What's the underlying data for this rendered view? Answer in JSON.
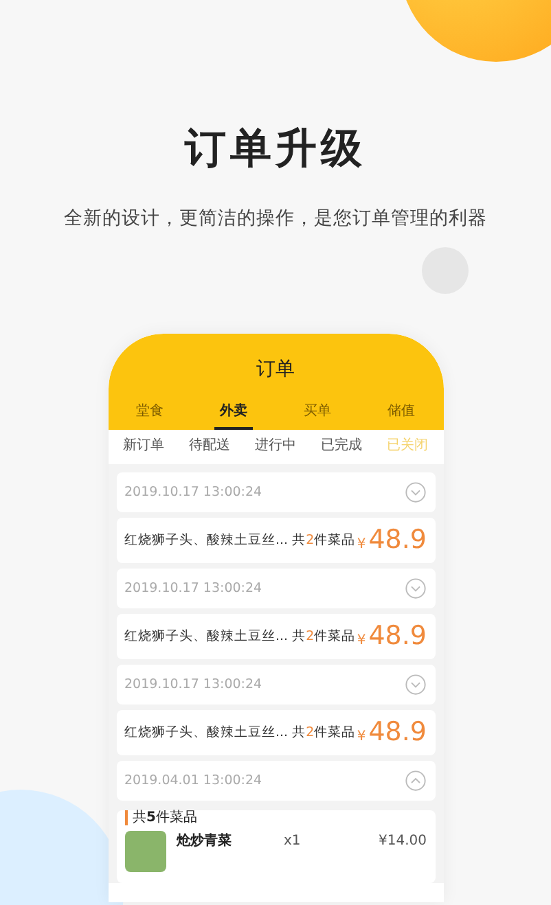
{
  "headline": "订单升级",
  "tagline": "全新的设计，更简洁的操作，是您订单管理的利器",
  "phone": {
    "title": "订单",
    "tabs": [
      {
        "label": "堂食",
        "selected": false
      },
      {
        "label": "外卖",
        "selected": true
      },
      {
        "label": "买单",
        "selected": false
      },
      {
        "label": "储值",
        "selected": false
      }
    ],
    "status_tabs": [
      {
        "label": "新订单",
        "selected": false
      },
      {
        "label": "待配送",
        "selected": false
      },
      {
        "label": "进行中",
        "selected": false
      },
      {
        "label": "已完成",
        "selected": false
      },
      {
        "label": "已关闭",
        "selected": true
      }
    ],
    "orders": [
      {
        "time": "2019.10.17 13:00:24",
        "expanded": false,
        "summary": "红烧狮子头、酸辣土豆丝...",
        "count": "共**2**件菜品",
        "price": {
          "currency": "¥",
          "amount": "48.9"
        }
      },
      {
        "time": "2019.10.17 13:00:24",
        "expanded": false,
        "summary": "红烧狮子头、酸辣土豆丝...",
        "count": "共**2**件菜品",
        "price": {
          "currency": "¥",
          "amount": "48.9"
        }
      },
      {
        "time": "2019.10.17 13:00:24",
        "expanded": false,
        "summary": "红烧狮子头、酸辣土豆丝...",
        "count": "共**2**件菜品",
        "price": {
          "currency": "¥",
          "amount": "48.9"
        }
      },
      {
        "time": "2019.04.01 13:00:24",
        "expanded": true,
        "count": "共**5**件菜品",
        "items": [
          {
            "name": "炝炒青菜",
            "qty": "x1",
            "price": "¥14.00"
          }
        ]
      }
    ]
  }
}
